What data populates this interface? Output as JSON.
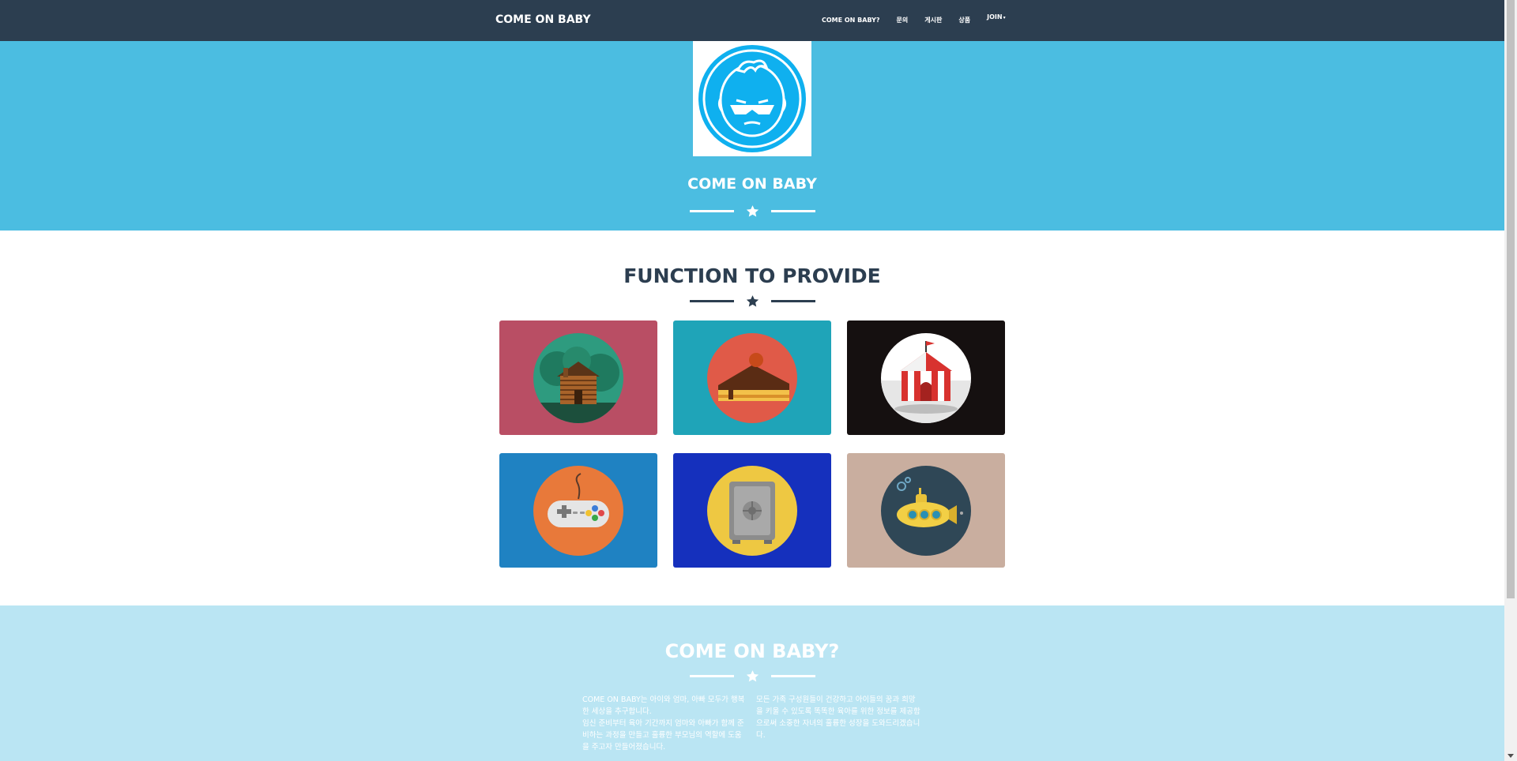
{
  "navbar": {
    "brand": "COME ON BABY",
    "items": [
      {
        "label": "COME ON BABY?"
      },
      {
        "label": "문의"
      },
      {
        "label": "게시판"
      },
      {
        "label": "상품"
      },
      {
        "label": "JOIN"
      }
    ]
  },
  "hero": {
    "title": "COME ON BABY",
    "logo_icon": "baby-face-logo"
  },
  "functions": {
    "title": "FUNCTION TO PROVIDE",
    "cards": [
      {
        "icon": "log-cabin-icon",
        "bg": "#b94e64",
        "circle": "#2e9b7f"
      },
      {
        "icon": "cake-slice-icon",
        "bg": "#1fa4b8",
        "circle": "#e05a48"
      },
      {
        "icon": "circus-tent-icon",
        "bg": "#151010",
        "circle": "#ffffff"
      },
      {
        "icon": "game-controller-icon",
        "bg": "#1f82c2",
        "circle": "#e8793a"
      },
      {
        "icon": "safe-icon",
        "bg": "#1530bd",
        "circle": "#eec842"
      },
      {
        "icon": "submarine-icon",
        "bg": "#c9ae9f",
        "circle": "#2f4756"
      }
    ]
  },
  "about": {
    "title": "COME ON BABY?",
    "left_text": "COME ON BABY는 아이와 엄마, 아빠 모두가 행복한 세상을 추구합니다.\n임신 준비부터 육아 기간까지 엄마와 아빠가 함께 준비하는 과정을 만들고 훌륭한 부모님의 역할에 도움을 주고자 만들어졌습니다.",
    "right_text": "모든 가족 구성원들이 건강하고 아이들의 꿈과 희망을 키울 수 있도록 똑똑한 육아를 위한 정보를 제공함으로써 소중한 자녀의 훌륭한 성장을 도와드리겠습니다."
  },
  "colors": {
    "navbar": "#2c3e50",
    "hero": "#4bbde1",
    "about": "#bae5f3",
    "heading": "#2c3e50"
  }
}
